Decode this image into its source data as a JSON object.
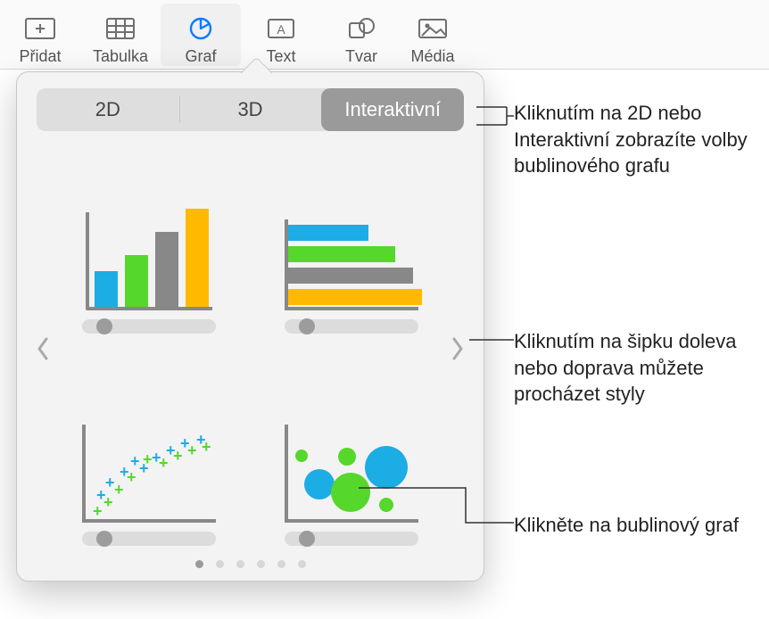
{
  "toolbar": {
    "items": [
      {
        "label": "Přidat",
        "icon": "insert-icon"
      },
      {
        "label": "Tabulka",
        "icon": "table-icon"
      },
      {
        "label": "Graf",
        "icon": "chart-icon"
      },
      {
        "label": "Text",
        "icon": "textbox-icon"
      },
      {
        "label": "Tvar",
        "icon": "shape-icon"
      },
      {
        "label": "Média",
        "icon": "media-icon"
      }
    ],
    "active": "Graf"
  },
  "popover": {
    "tabs": {
      "t2d": "2D",
      "t3d": "3D",
      "interactive": "Interaktivní"
    },
    "selected_tab": "Interaktivní",
    "charts": {
      "column": "interactive-column-chart",
      "bar": "interactive-bar-chart",
      "scatter": "interactive-scatter-chart",
      "bubble": "interactive-bubble-chart"
    },
    "page_count": 6,
    "page_index": 0
  },
  "callouts": {
    "tabs": "Kliknutím na 2D nebo Interaktivní zobrazíte volby bublinového grafu",
    "arrows": "Kliknutím na šipku doleva nebo doprava můžete procházet styly",
    "bubble": "Klikněte na bublinový graf"
  },
  "colors": {
    "blue": "#1cade4",
    "green": "#56d72b",
    "gray": "#888888",
    "yellow": "#ffba00",
    "accent": "#0a7bff"
  }
}
